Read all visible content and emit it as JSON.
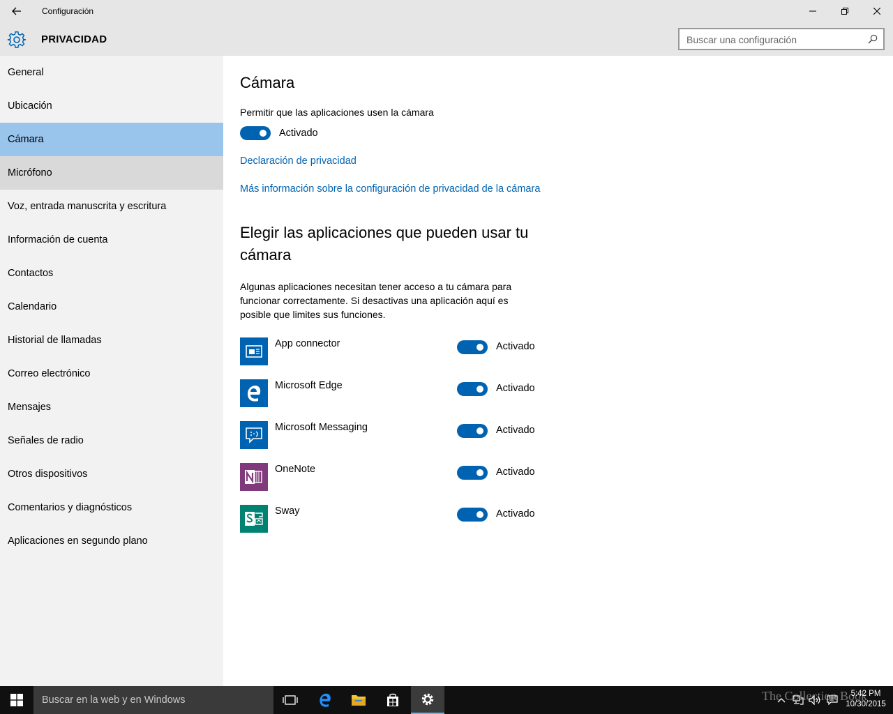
{
  "window": {
    "title": "Configuración"
  },
  "header": {
    "section_title": "PRIVACIDAD",
    "search_placeholder": "Buscar una configuración"
  },
  "sidebar": {
    "items": [
      {
        "label": "General"
      },
      {
        "label": "Ubicación"
      },
      {
        "label": "Cámara",
        "selected": true
      },
      {
        "label": "Micrófono"
      },
      {
        "label": "Voz, entrada manuscrita y escritura"
      },
      {
        "label": "Información de cuenta"
      },
      {
        "label": "Contactos"
      },
      {
        "label": "Calendario"
      },
      {
        "label": "Historial de llamadas"
      },
      {
        "label": "Correo electrónico"
      },
      {
        "label": "Mensajes"
      },
      {
        "label": "Señales de radio"
      },
      {
        "label": "Otros dispositivos"
      },
      {
        "label": "Comentarios y diagnósticos"
      },
      {
        "label": "Aplicaciones en segundo plano"
      }
    ]
  },
  "main": {
    "title": "Cámara",
    "allow_label": "Permitir que las aplicaciones usen la cámara",
    "allow_toggle": {
      "state": "Activado",
      "on": true
    },
    "privacy_link": "Declaración de privacidad",
    "more_info_link": "Más información sobre la configuración de privacidad de la cámara",
    "choose_title": "Elegir las aplicaciones que pueden usar tu cámara",
    "choose_desc": "Algunas aplicaciones necesitan tener acceso a tu cámara para funcionar correctamente. Si desactivas una aplicación aquí es posible que limites sus funciones.",
    "apps": [
      {
        "name": "App connector",
        "state": "Activado",
        "on": true,
        "icon": "app-connector-icon",
        "color": "#0063b1"
      },
      {
        "name": "Microsoft Edge",
        "state": "Activado",
        "on": true,
        "icon": "edge-icon",
        "color": "#0063b1"
      },
      {
        "name": "Microsoft Messaging",
        "state": "Activado",
        "on": true,
        "icon": "messaging-icon",
        "color": "#0063b1"
      },
      {
        "name": "OneNote",
        "state": "Activado",
        "on": true,
        "icon": "onenote-icon",
        "color": "#80397b"
      },
      {
        "name": "Sway",
        "state": "Activado",
        "on": true,
        "icon": "sway-icon",
        "color": "#008272"
      }
    ]
  },
  "taskbar": {
    "search_placeholder": "Buscar en la web y en Windows",
    "time": "5:42 PM",
    "date": "10/30/2015",
    "watermark": "The Collection Book"
  },
  "colors": {
    "accent": "#0063b1",
    "selected_nav": "#99c4eb",
    "sidebar_bg": "#f2f2f2",
    "titlebar_bg": "#e6e6e6",
    "taskbar_bg": "#101010"
  }
}
